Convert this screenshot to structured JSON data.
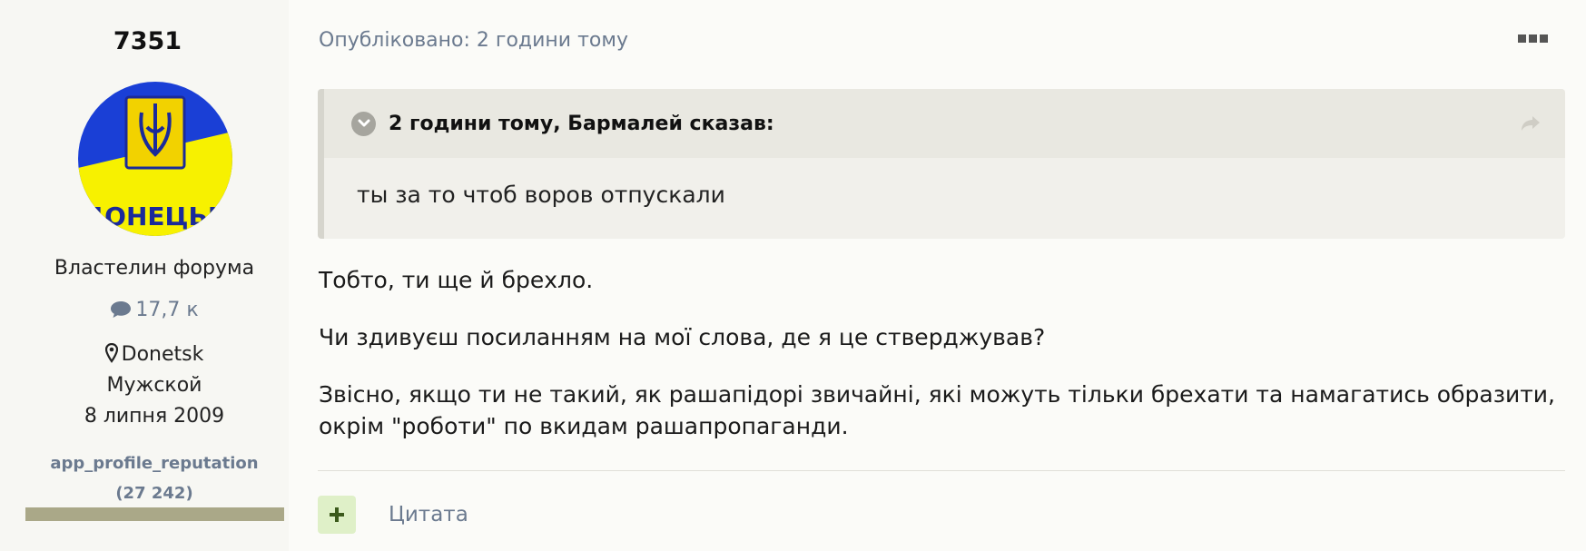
{
  "author": {
    "username": "7351",
    "avatar_text": "ДОНЕЦЬК",
    "rank": "Властелин форума",
    "post_count": "17,7 к",
    "location": "Donetsk",
    "gender": "Мужской",
    "joined": "8 липня 2009",
    "reputation_label": "app_profile_reputation",
    "reputation_value": "(27 242)"
  },
  "post": {
    "published": "Опубліковано: 2 години тому",
    "quote": {
      "citation": "2 години тому, Бармалей сказав:",
      "text": "ты за то чтоб воров отпускали"
    },
    "paragraphs": [
      "Тобто, ти ще й брехло.",
      "Чи здивуєш посиланням на мої слова, де я це стверджував?",
      "Звісно, якщо ти не такий, як рашапідорі звичайні, які можуть тільки брехати та намагатись образити, окрім \"роботи\" по вкидам рашапропаганди."
    ],
    "quote_button_label": "Цитата"
  },
  "colors": {
    "accent_text": "#6b7a8f",
    "reaction_bg": "#dff0c8",
    "reputation_bar": "#aaa888"
  }
}
